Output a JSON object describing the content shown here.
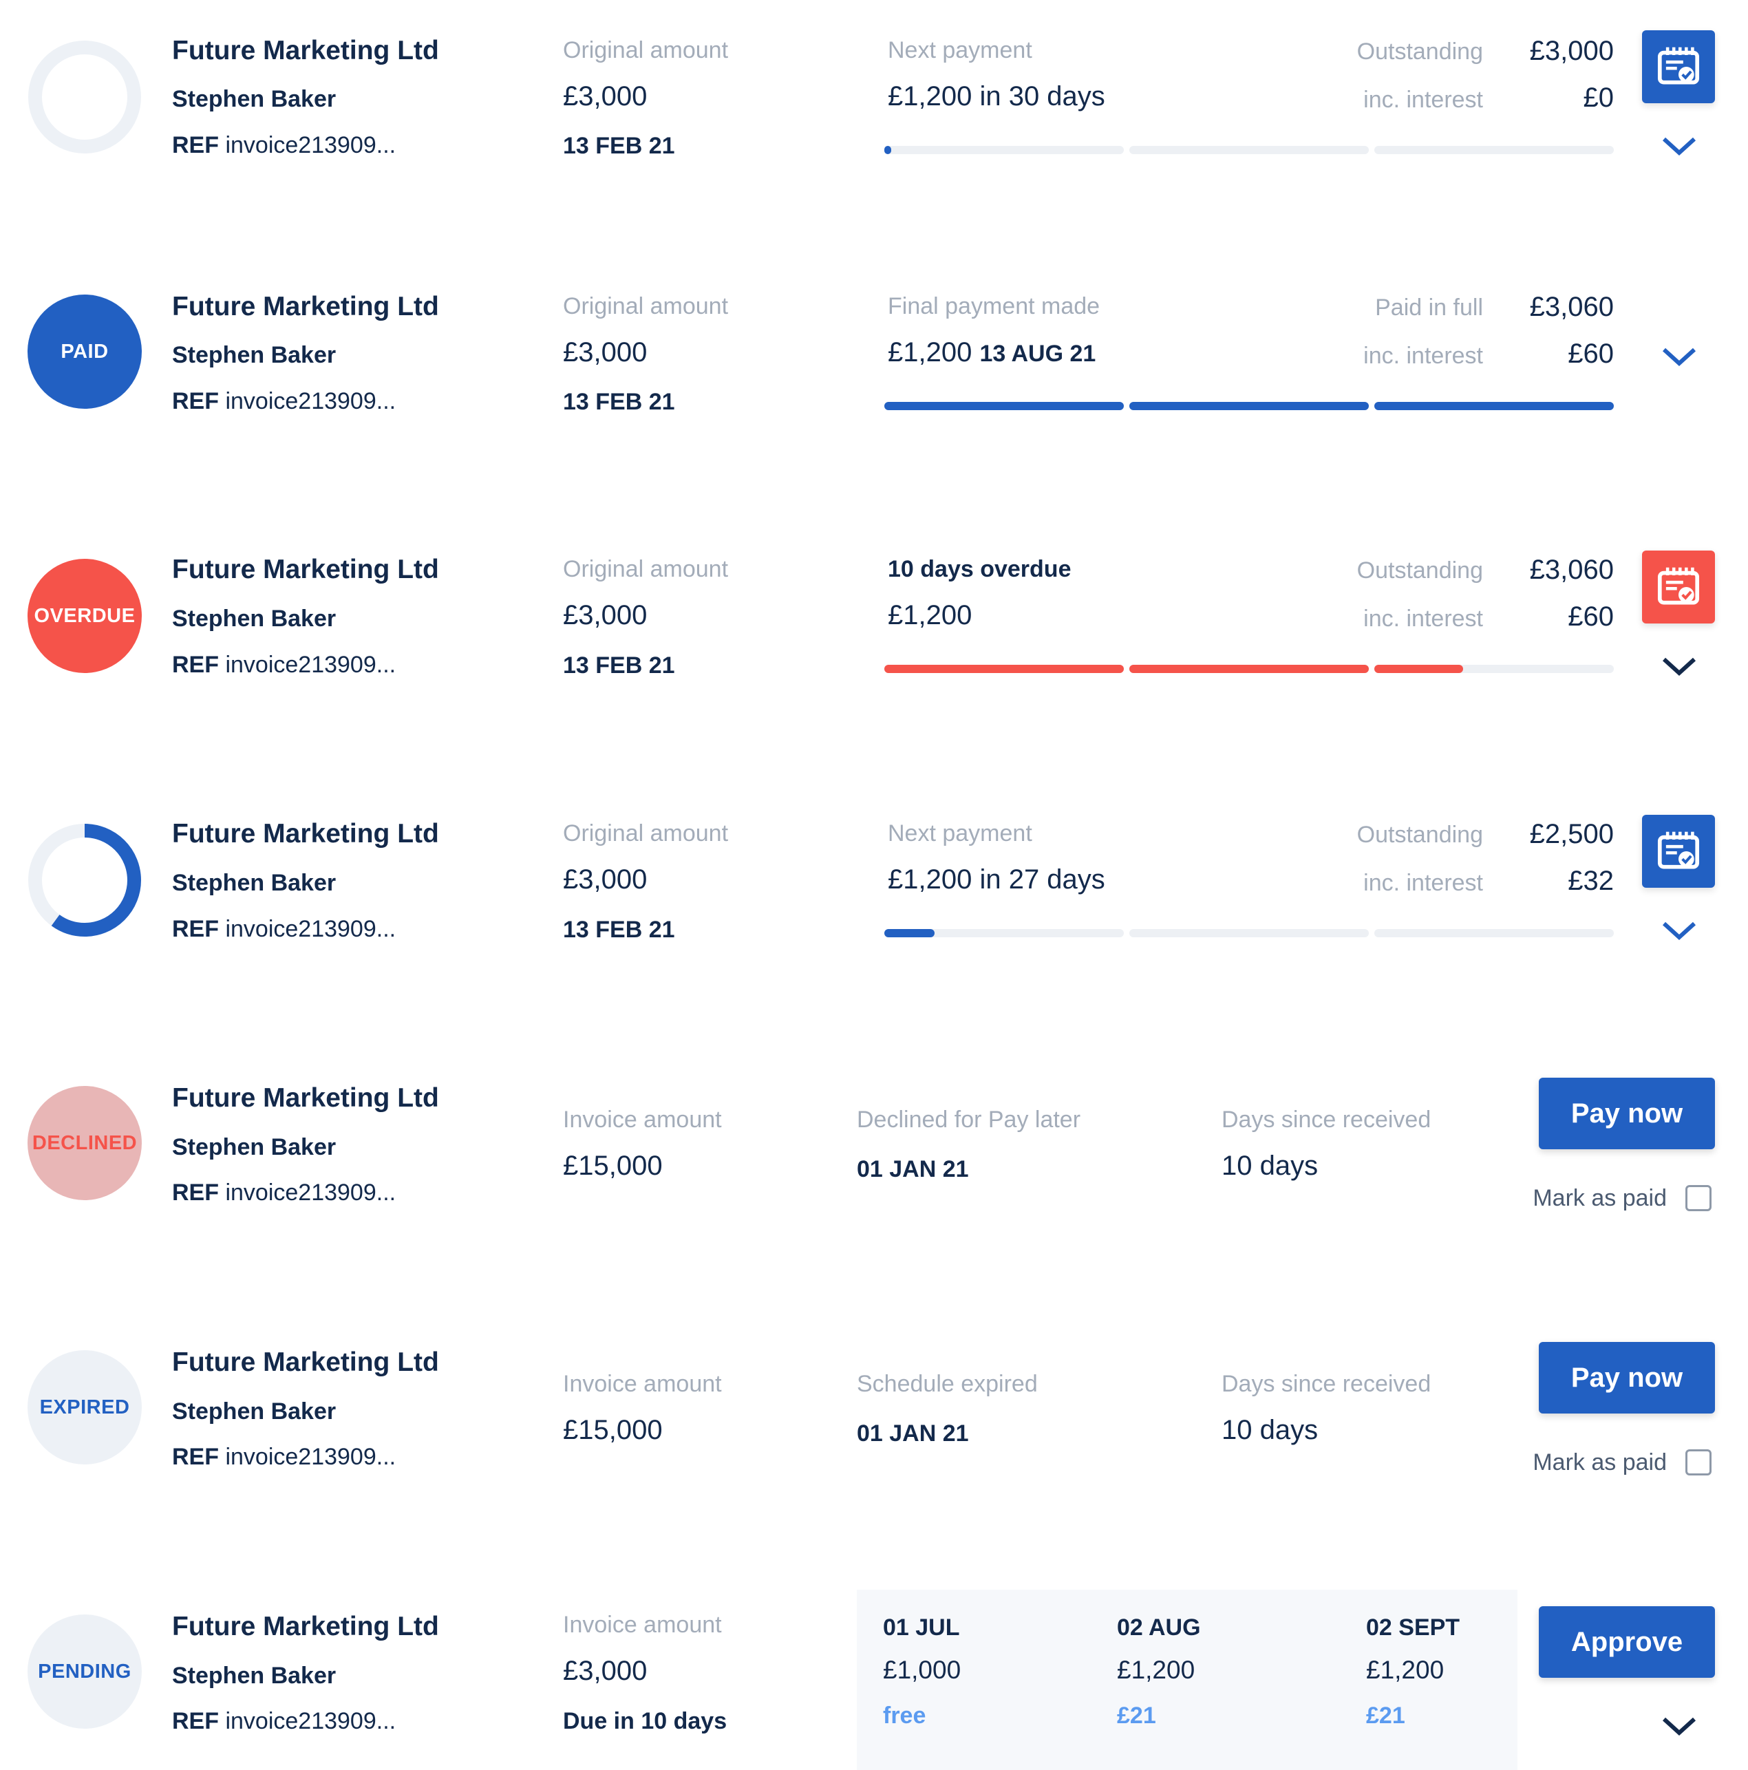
{
  "rows": [
    {
      "status": "",
      "company": "Future Marketing Ltd",
      "person": "Stephen Baker",
      "ref_prefix": "REF",
      "ref": "invoice213909...",
      "amount_label": "Original amount",
      "amount": "£3,000",
      "date": "13 FEB 21",
      "payment_label": "Next payment",
      "payment_value": "£1,200 in 30 days",
      "outstanding_label": "Outstanding",
      "outstanding_value": "£3,000",
      "interest_label": "inc. interest",
      "interest_value": "£0",
      "progress": 0.01,
      "progress_color": "#2260c2",
      "icon": "calendar-card-icon"
    },
    {
      "status": "PAID",
      "company": "Future Marketing Ltd",
      "person": "Stephen Baker",
      "ref_prefix": "REF",
      "ref": "invoice213909...",
      "amount_label": "Original amount",
      "amount": "£3,000",
      "date": "13 FEB 21",
      "payment_label": "Final payment made",
      "payment_amount": "£1,200",
      "payment_date": "13 AUG 21",
      "outstanding_label": "Paid in full",
      "outstanding_value": "£3,060",
      "interest_label": "inc. interest",
      "interest_value": "£60",
      "progress": 1.0,
      "progress_color": "#2260c2"
    },
    {
      "status": "OVERDUE",
      "company": "Future Marketing Ltd",
      "person": "Stephen Baker",
      "ref_prefix": "REF",
      "ref": "invoice213909...",
      "amount_label": "Original amount",
      "amount": "£3,000",
      "date": "13 FEB 21",
      "payment_label": "10 days overdue",
      "payment_value": "£1,200",
      "outstanding_label": "Outstanding",
      "outstanding_value": "£3,060",
      "interest_label": "inc. interest",
      "interest_value": "£60",
      "progress": 0.79,
      "progress_color": "#f5534a",
      "icon": "calendar-card-icon"
    },
    {
      "status": "",
      "company": "Future Marketing Ltd",
      "person": "Stephen Baker",
      "ref_prefix": "REF",
      "ref": "invoice213909...",
      "amount_label": "Original amount",
      "amount": "£3,000",
      "date": "13 FEB 21",
      "payment_label": "Next payment",
      "payment_value": "£1,200 in 27 days",
      "outstanding_label": "Outstanding",
      "outstanding_value": "£2,500",
      "interest_label": "inc. interest",
      "interest_value": "£32",
      "progress": 0.07,
      "progress_color": "#2260c2",
      "ring_progress": 0.6,
      "icon": "calendar-card-icon"
    },
    {
      "status": "DECLINED",
      "company": "Future Marketing Ltd",
      "person": "Stephen Baker",
      "ref_prefix": "REF",
      "ref": "invoice213909...",
      "amount_label": "Invoice amount",
      "amount": "£15,000",
      "mid_label": "Declined for Pay later",
      "mid_value": "01 JAN 21",
      "days_label": "Days since received",
      "days_value": "10 days",
      "button": "Pay now",
      "mark_paid": "Mark as paid"
    },
    {
      "status": "EXPIRED",
      "company": "Future Marketing Ltd",
      "person": "Stephen Baker",
      "ref_prefix": "REF",
      "ref": "invoice213909...",
      "amount_label": "Invoice amount",
      "amount": "£15,000",
      "mid_label": "Schedule expired",
      "mid_value": "01 JAN 21",
      "days_label": "Days since received",
      "days_value": "10 days",
      "button": "Pay now",
      "mark_paid": "Mark as paid"
    },
    {
      "status": "PENDING",
      "company": "Future Marketing Ltd",
      "person": "Stephen Baker",
      "ref_prefix": "REF",
      "ref": "invoice213909...",
      "amount_label": "Invoice amount",
      "amount": "£3,000",
      "due": "Due in 10 days",
      "schedule": [
        {
          "date": "01 JUL",
          "amount": "£1,000",
          "fee": "free"
        },
        {
          "date": "02 AUG",
          "amount": "£1,200",
          "fee": "£21"
        },
        {
          "date": "02 SEPT",
          "amount": "£1,200",
          "fee": "£21"
        }
      ],
      "button": "Approve"
    }
  ],
  "colors": {
    "navy": "#13294b",
    "blue": "#2260c2",
    "red": "#f5534a",
    "muted": "#a3acb9",
    "declined_bg": "#e8b6b6",
    "light_bg": "#edf1f6"
  }
}
